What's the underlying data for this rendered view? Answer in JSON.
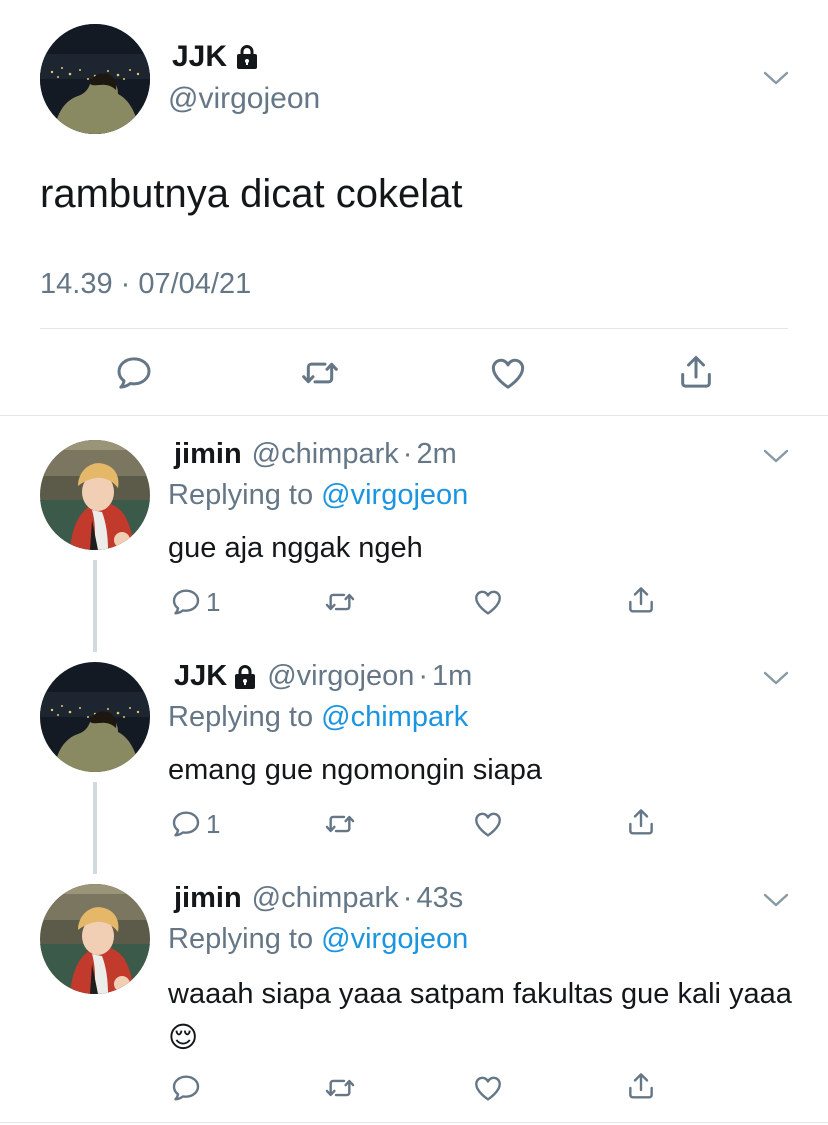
{
  "main_tweet": {
    "name": "JJK",
    "handle": "@virgojeon",
    "text": "rambutnya dicat cokelat",
    "timestamp": "14.39 · 07/04/21",
    "actions": [
      "reply-icon",
      "retweet-icon",
      "like-icon",
      "share-icon"
    ]
  },
  "replies": [
    {
      "name": "jimin",
      "handle": "@chimpark",
      "dot": "·",
      "time": "2m",
      "replying_prefix": "Replying to",
      "replying_to": "@virgojeon",
      "text": "gue aja nggak ngeh",
      "reply_count": "1"
    },
    {
      "name": "JJK",
      "handle": "@virgojeon",
      "dot": "·",
      "time": "1m",
      "replying_prefix": "Replying to",
      "replying_to": "@chimpark",
      "text": "emang gue ngomongin siapa",
      "reply_count": "1"
    },
    {
      "name": "jimin",
      "handle": "@chimpark",
      "dot": "·",
      "time": "43s",
      "replying_prefix": "Replying to",
      "replying_to": "@virgojeon",
      "text": "waaah siapa yaaa satpam fakultas gue kali yaaa",
      "emoji": "😌",
      "reply_count": ""
    }
  ],
  "colors": {
    "link": "#1b95e0",
    "secondary_text": "#657786",
    "divider": "#e1e8ed",
    "thread_line": "#cfd9de"
  }
}
